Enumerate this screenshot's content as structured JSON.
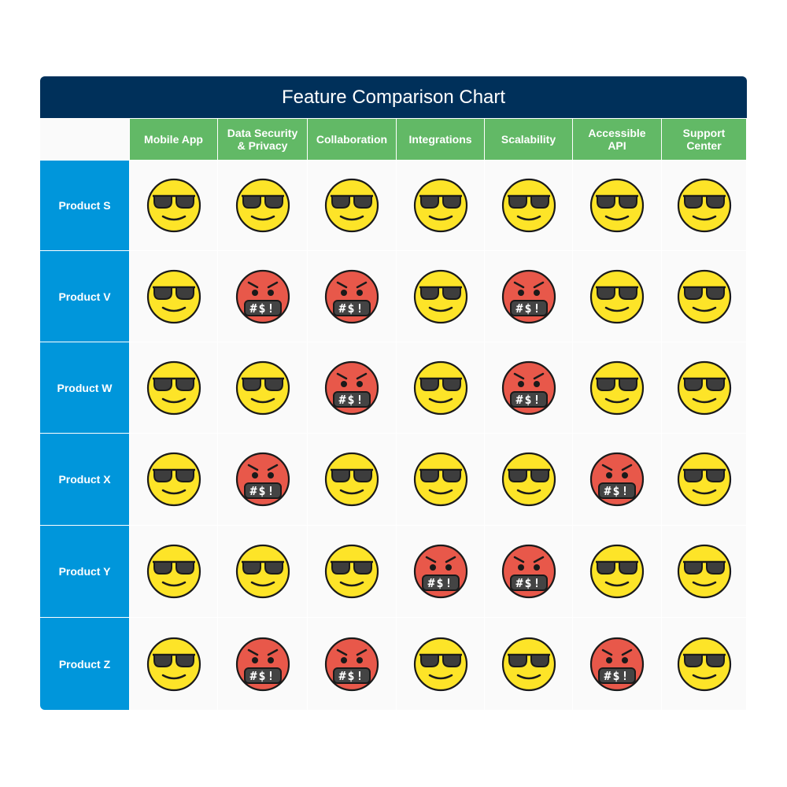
{
  "chart_data": {
    "type": "table",
    "title": "Feature Comparison Chart",
    "columns": [
      "Mobile App",
      "Data Security & Privacy",
      "Collaboration",
      "Integrations",
      "Scalability",
      "Accessible API",
      "Support Center"
    ],
    "column_lines": [
      [
        "Mobile App"
      ],
      [
        "Data Security",
        "& Privacy"
      ],
      [
        "Collaboration"
      ],
      [
        "Integrations"
      ],
      [
        "Scalability"
      ],
      [
        "Accessible",
        "API"
      ],
      [
        "Support",
        "Center"
      ]
    ],
    "rows": [
      "Product S",
      "Product V",
      "Product W",
      "Product X",
      "Product Y",
      "Product Z"
    ],
    "values": [
      [
        "cool",
        "cool",
        "cool",
        "cool",
        "cool",
        "cool",
        "cool"
      ],
      [
        "cool",
        "angry",
        "angry",
        "cool",
        "angry",
        "cool",
        "cool"
      ],
      [
        "cool",
        "cool",
        "angry",
        "cool",
        "angry",
        "cool",
        "cool"
      ],
      [
        "cool",
        "angry",
        "cool",
        "cool",
        "cool",
        "angry",
        "cool"
      ],
      [
        "cool",
        "cool",
        "cool",
        "angry",
        "angry",
        "cool",
        "cool"
      ],
      [
        "cool",
        "angry",
        "angry",
        "cool",
        "cool",
        "angry",
        "cool"
      ]
    ],
    "icons": {
      "cool": "smiling-face-with-sunglasses-icon",
      "angry": "face-with-symbols-on-mouth-icon"
    },
    "angry_symbols": "#$!",
    "colors": {
      "title_bg": "#00305a",
      "header_bg": "#62b966",
      "row_header_bg": "#0096db",
      "cell_bg": "#fafafa",
      "cool_face": "#fde428",
      "angry_face": "#e8584a"
    }
  }
}
